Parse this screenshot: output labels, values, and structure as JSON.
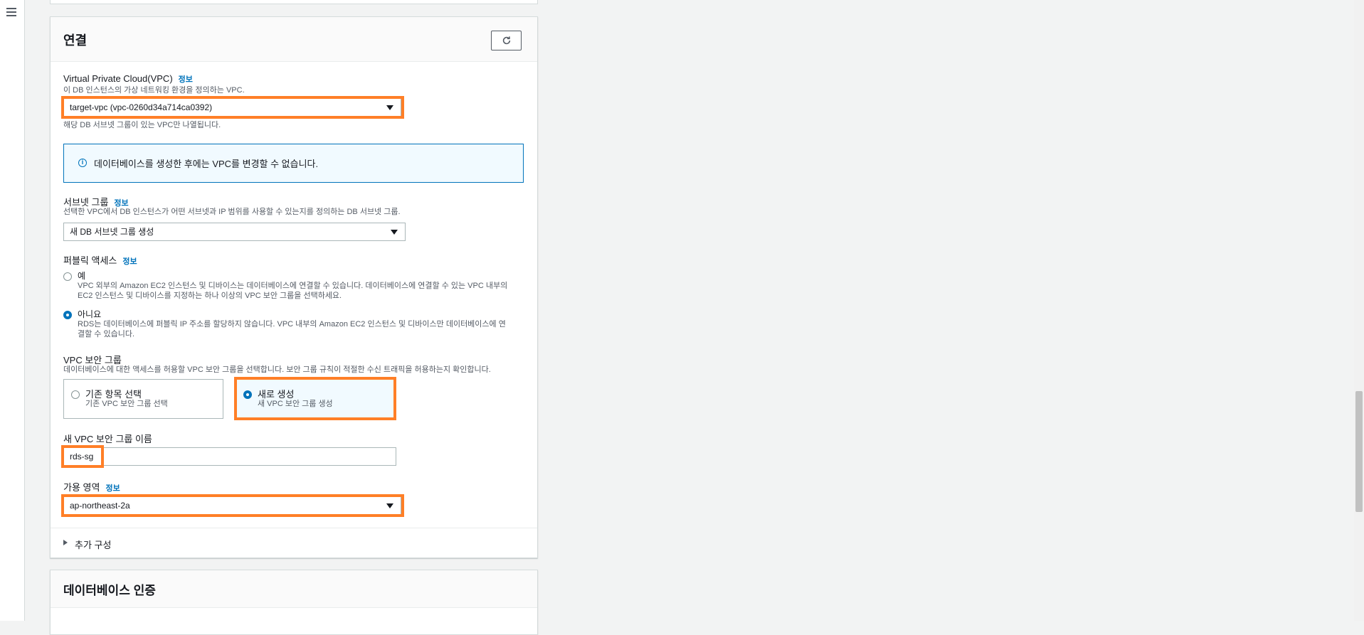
{
  "nav": {
    "menu_icon": "hamburger-icon"
  },
  "connectivity": {
    "title": "연결",
    "refresh_icon": "refresh-icon",
    "vpc": {
      "label": "Virtual Private Cloud(VPC)",
      "info": "정보",
      "description": "이 DB 인스턴스의 가상 네트워킹 환경을 정의하는 VPC.",
      "value": "target-vpc (vpc-0260d34a714ca0392)",
      "hint": "해당 DB 서브넷 그룹이 있는 VPC만 나열됩니다."
    },
    "alert": "데이터베이스를 생성한 후에는 VPC를 변경할 수 없습니다.",
    "subnet_group": {
      "label": "서브넷 그룹",
      "info": "정보",
      "description": "선택한 VPC에서 DB 인스턴스가 어떤 서브넷과 IP 범위를 사용할 수 있는지를 정의하는 DB 서브넷 그룹.",
      "value": "새 DB 서브넷 그룹 생성"
    },
    "public_access": {
      "label": "퍼블릭 액세스",
      "info": "정보",
      "yes_label": "예",
      "yes_desc_1": "VPC 외부의 Amazon EC2 인스턴스 및 디바이스는 데이터베이스에 연결할 수 있습니다. 데이터베이스에 연결할 수 있는 VPC 내부의",
      "yes_desc_2": "EC2 인스턴스 및 디바이스를 지정하는 하나 이상의 VPC 보안 그룹을 선택하세요.",
      "no_label": "아니요",
      "no_desc_1": "RDS는 데이터베이스에 퍼블릭 IP 주소를 할당하지 않습니다. VPC 내부의 Amazon EC2 인스턴스 및 디바이스만 데이터베이스에 연",
      "no_desc_2": "결할 수 있습니다.",
      "selected": "아니요"
    },
    "security_group": {
      "label": "VPC 보안 그룹",
      "description": "데이터베이스에 대한 액세스를 허용할 VPC 보안 그룹을 선택합니다. 보안 그룹 규칙이 적절한 수신 트래픽을 허용하는지 확인합니다.",
      "existing_title": "기존 항목 선택",
      "existing_desc": "기존 VPC 보안 그룹 선택",
      "new_title": "새로 생성",
      "new_desc": "새 VPC 보안 그룹 생성",
      "selected": "새로 생성"
    },
    "new_sg_name": {
      "label": "새 VPC 보안 그룹 이름",
      "value": "rds-sg"
    },
    "availability_zone": {
      "label": "가용 영역",
      "info": "정보",
      "value": "ap-northeast-2a"
    },
    "additional_config": "추가 구성"
  },
  "auth": {
    "title": "데이터베이스 인증"
  },
  "highlight_color": "#ff7f27",
  "accent_color": "#0073bb"
}
